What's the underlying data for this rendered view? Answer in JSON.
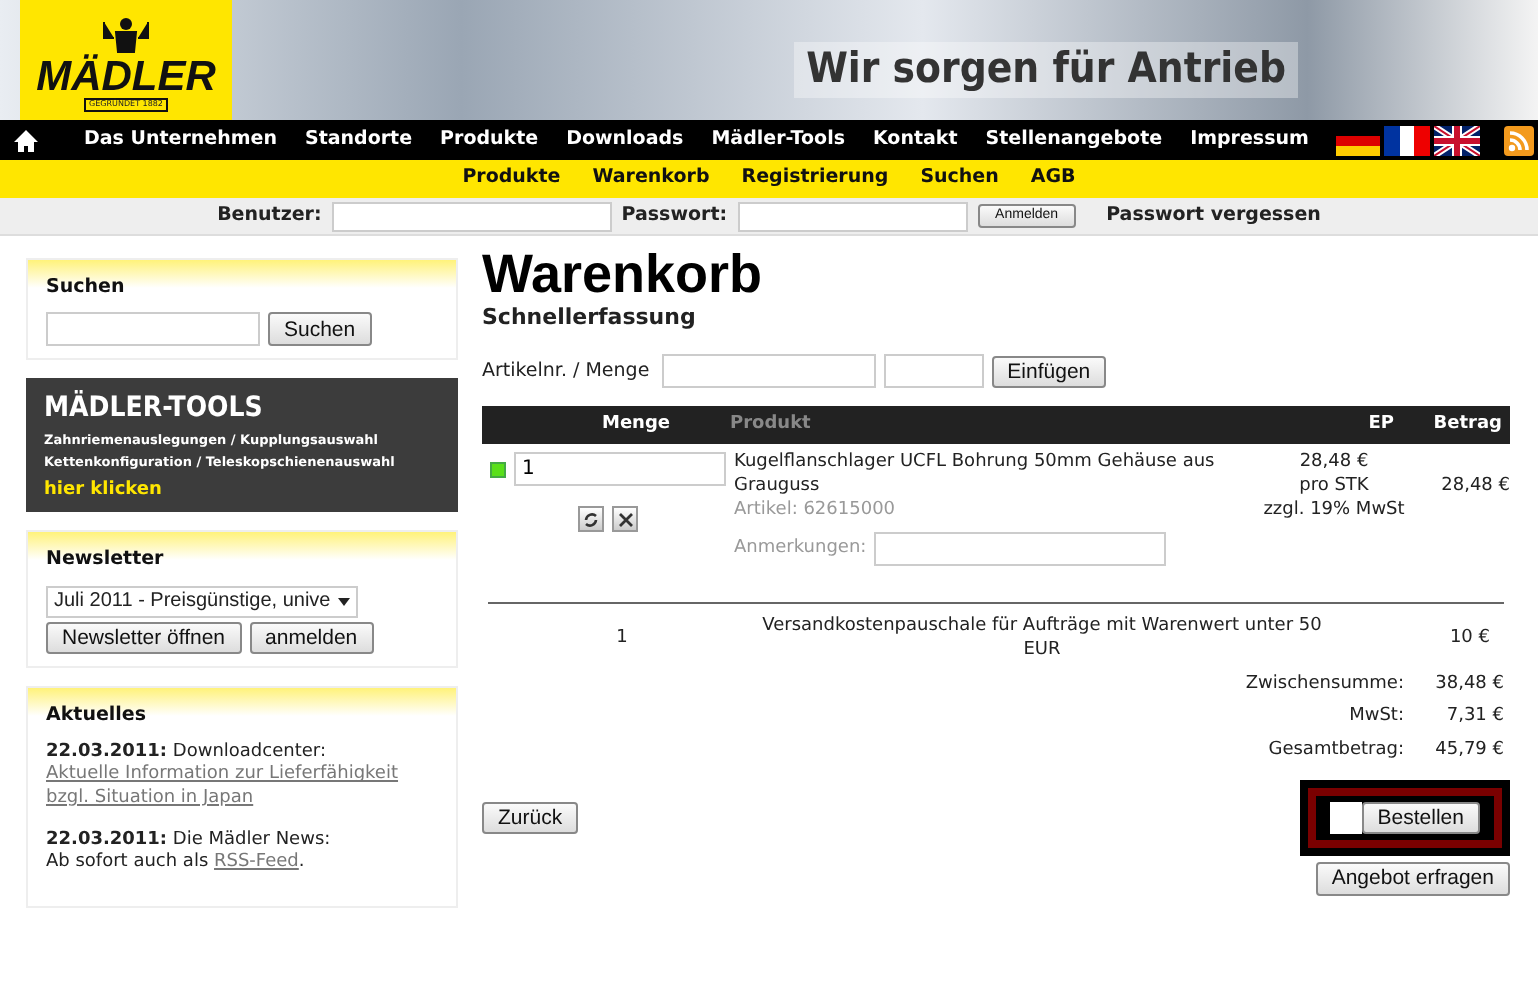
{
  "header": {
    "logo": "MÄDLER",
    "logo_sub": "GEGRÜNDET 1882",
    "slogan": "Wir sorgen für Antrieb"
  },
  "main_nav": [
    "Das Unternehmen",
    "Standorte",
    "Produkte",
    "Downloads",
    "Mädler-Tools",
    "Kontakt",
    "Stellenangebote",
    "Impressum"
  ],
  "sub_nav": [
    "Produkte",
    "Warenkorb",
    "Registrierung",
    "Suchen",
    "AGB"
  ],
  "login": {
    "user_label": "Benutzer:",
    "password_label": "Passwort:",
    "button": "Anmelden",
    "forgot": "Passwort vergessen"
  },
  "sidebar": {
    "search": {
      "title": "Suchen",
      "button": "Suchen"
    },
    "tools": {
      "title": "MÄDLER-TOOLS",
      "lines": [
        "Zahnriemenauslegungen / Kupplungsauswahl",
        "Kettenkonfiguration / Teleskopschienenauswahl"
      ],
      "link": "hier klicken"
    },
    "newsletter": {
      "title": "Newsletter",
      "select": "Juli 2011 - Preisgünstige, unive",
      "buttons": [
        "Newsletter öffnen",
        "anmelden"
      ]
    },
    "news": {
      "title": "Aktuelles",
      "items": [
        {
          "date": "22.03.2011:",
          "text": "Downloadcenter:",
          "link": "Aktuelle Information zur Lieferfähigkeit bzgl. Situation in Japan"
        },
        {
          "date": "22.03.2011:",
          "text": "Die Mädler News:",
          "pre": "Ab sofort auch als ",
          "link": "RSS-Feed",
          "after": "."
        }
      ]
    }
  },
  "cart": {
    "title": "Warenkorb",
    "subtitle": "Schnellerfassung",
    "quick_label": "Artikelnr. / Menge",
    "quick_button": "Einfügen",
    "columns": [
      "Menge",
      "Produkt",
      "EP",
      "Betrag"
    ],
    "items": [
      {
        "available": true,
        "quantity": "1",
        "product": "Kugelflanschlager UCFL Bohrung 50mm Gehäuse aus Grauguss",
        "article": "Artikel: 62615000",
        "price": [
          "28,48 €",
          "pro STK",
          "zzgl. 19% MwSt"
        ],
        "amount": "28,48 €",
        "remarks_label": "Anmerkungen:"
      }
    ],
    "shipping": {
      "quantity": "1",
      "text": "Versandkostenpauschale für Aufträge mit Warenwert unter 50 EUR",
      "amount": "10 €"
    },
    "totals": [
      {
        "label": "Zwischensumme:",
        "value": "38,48 €"
      },
      {
        "label": "MwSt:",
        "value": "7,31 €"
      },
      {
        "label": "Gesamtbetrag:",
        "value": "45,79 €"
      }
    ],
    "back_button": "Zurück",
    "order_button": "Bestellen",
    "order_highlighted": true,
    "quote_button": "Angebot erfragen"
  }
}
